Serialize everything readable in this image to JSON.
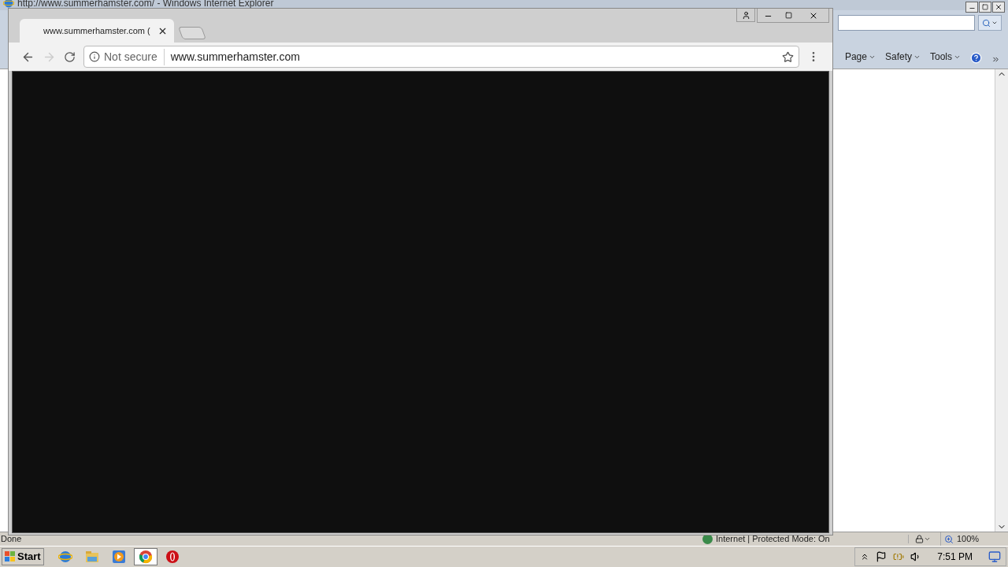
{
  "ie_window": {
    "title": "http://www.summerhamster.com/ - Windows Internet Explorer",
    "command_bar": [
      {
        "label": "Page"
      },
      {
        "label": "Safety"
      },
      {
        "label": "Tools"
      }
    ],
    "status_bar": {
      "status": "Done",
      "zone": "Internet | Protected Mode: On",
      "zoom": "100%"
    }
  },
  "chrome_window": {
    "tabs": [
      {
        "title": "www.summerhamster.com (",
        "selected": true
      }
    ],
    "security_label": "Not secure",
    "url": "www.summerhamster.com",
    "forward_disabled": true
  },
  "taskbar": {
    "start": "Start",
    "apps": [
      {
        "kind": "ie",
        "selected": false
      },
      {
        "kind": "folder",
        "selected": false
      },
      {
        "kind": "media",
        "selected": false
      },
      {
        "kind": "chrome",
        "selected": true
      },
      {
        "kind": "opera",
        "selected": false
      }
    ],
    "clock": "7:51 PM"
  }
}
